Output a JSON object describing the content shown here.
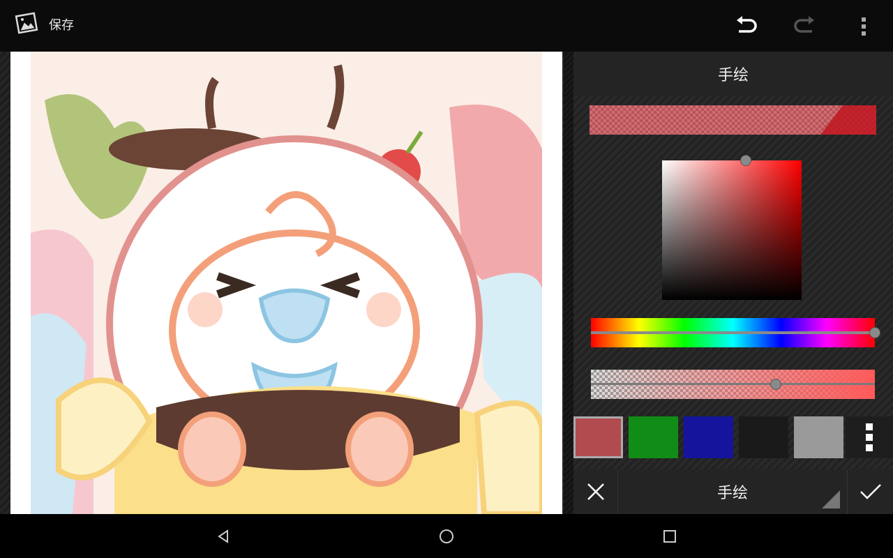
{
  "topbar": {
    "save_label": "保存",
    "icons": {
      "app": "picture-icon",
      "undo": "undo-icon",
      "redo": "redo-icon",
      "menu": "overflow-menu-icon"
    }
  },
  "panel": {
    "title": "手绘",
    "current_color": "#c83c46",
    "hue_level": 1.0,
    "alpha_level": 0.65,
    "swatches": [
      {
        "color": "#b24b50",
        "selected": true
      },
      {
        "color": "#118c17",
        "selected": false
      },
      {
        "color": "#14149c",
        "selected": false
      },
      {
        "color": "#1a1a1a",
        "selected": false
      },
      {
        "color": "#9a9a9a",
        "selected": false
      }
    ],
    "mode_label": "手绘"
  },
  "navbar": {
    "icons": [
      "back-icon",
      "home-icon",
      "recents-icon"
    ]
  }
}
